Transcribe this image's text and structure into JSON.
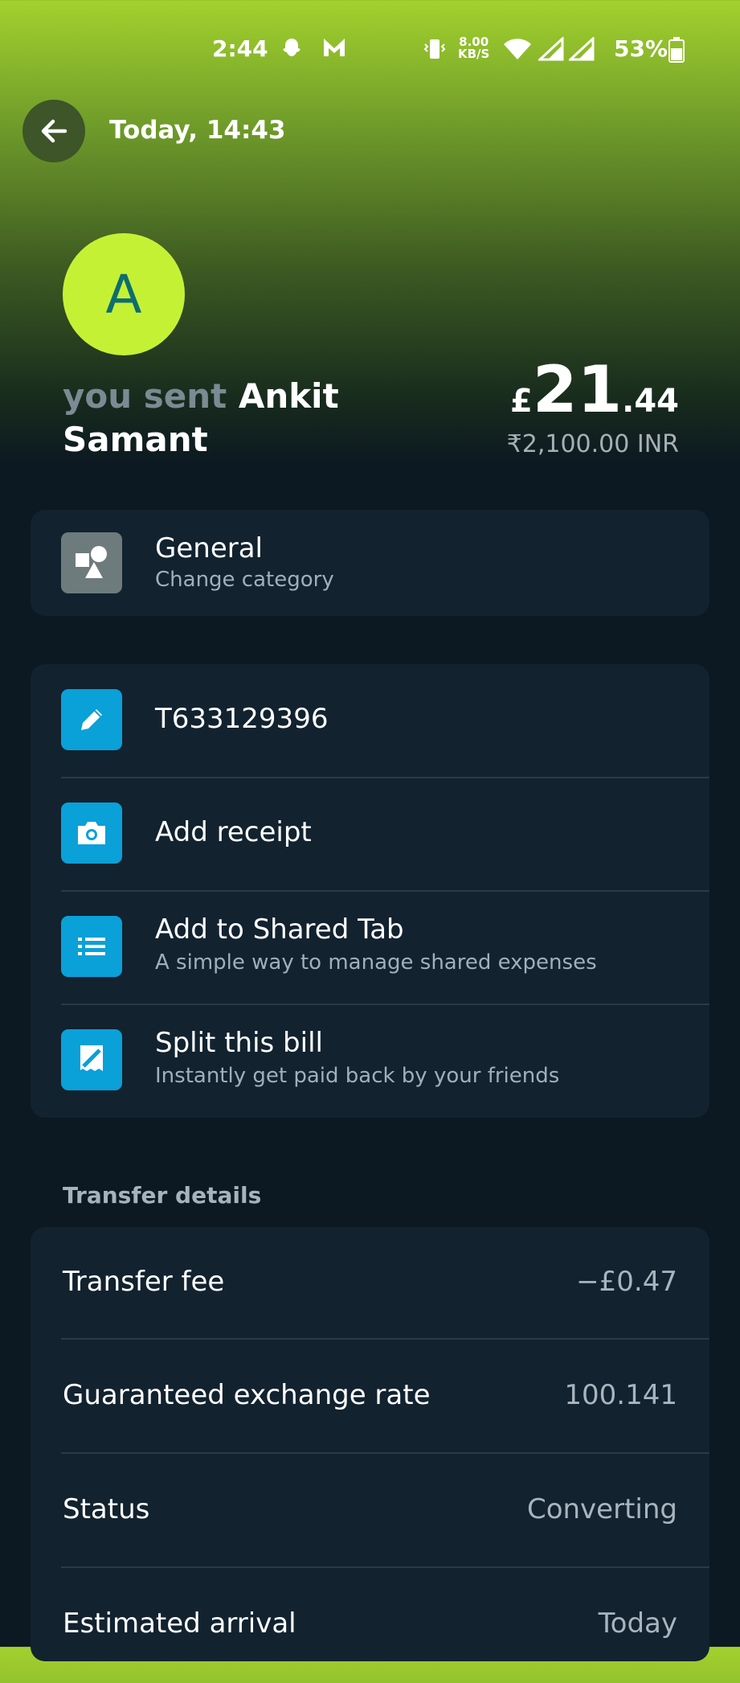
{
  "status_bar": {
    "time": "2:44",
    "speed_value": "8.00",
    "speed_unit": "KB/S",
    "battery": "53%",
    "icons": [
      "snapchat-icon",
      "m-app-icon",
      "vibrate-icon",
      "wifi-icon",
      "signal-icon",
      "signal-icon",
      "battery-icon"
    ]
  },
  "header": {
    "title": "Today, 14:43"
  },
  "transaction": {
    "avatar_initial": "A",
    "prefix": "you sent",
    "recipient": "Ankit Samant",
    "currency_symbol": "£",
    "amount_whole": "21",
    "amount_decimal": ".44",
    "converted": "₹2,100.00 INR"
  },
  "category": {
    "label": "General",
    "sub": "Change category"
  },
  "actions": [
    {
      "label": "T633129396",
      "sub": ""
    },
    {
      "label": "Add receipt",
      "sub": ""
    },
    {
      "label": "Add to Shared Tab",
      "sub": "A simple way to manage shared expenses"
    },
    {
      "label": "Split this bill",
      "sub": "Instantly get paid back by your friends"
    }
  ],
  "transfer_details": {
    "title": "Transfer details",
    "rows": [
      {
        "label": "Transfer fee",
        "value": "−£0.47"
      },
      {
        "label": "Guaranteed exchange rate",
        "value": "100.141"
      },
      {
        "label": "Status",
        "value": "Converting"
      },
      {
        "label": "Estimated arrival",
        "value": "Today"
      }
    ]
  },
  "colors": {
    "accent_lime": "#c5f135",
    "icon_blue": "#0aa0d8",
    "card_bg": "#12222f",
    "page_bg": "#0c1822"
  }
}
